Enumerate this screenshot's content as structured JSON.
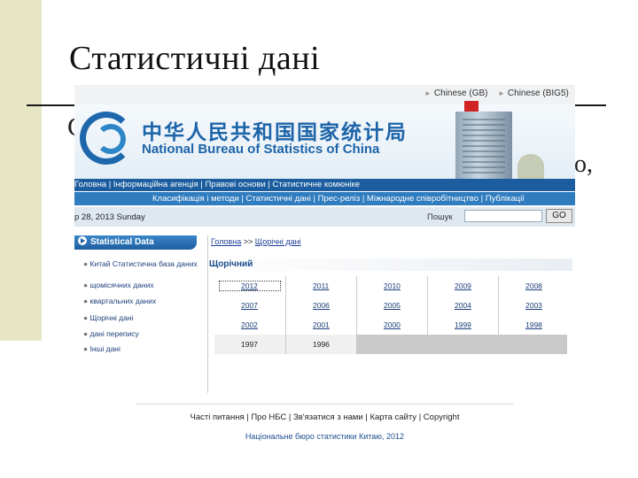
{
  "slide": {
    "title": "Статистичні дані",
    "fragment_left": "С",
    "fragment_right": "о,"
  },
  "header": {
    "lang_gb": "Chinese (GB)",
    "lang_big5": "Chinese (BIG5)",
    "cn_name": "中华人民共和国国家统计局",
    "en_name": "National Bureau of Statistics of China"
  },
  "nav": {
    "row1": "Головна | Інформаційна агенція | Правові основи | Статистичне комюніке",
    "row2": "Класифікація і методи | Статистичні дані | Прес-реліз | Міжнародне співробітництво | Публікації"
  },
  "datebar": {
    "date": "р 28, 2013 Sunday",
    "search_label": "Пошук",
    "search_value": "",
    "go_label": "GO"
  },
  "sidebar": {
    "heading": "Statistical Data",
    "items": [
      "Китай Статистична база даних",
      "щомісячних даних",
      "квартальних даних",
      "Щорічні дані",
      "дані перепису",
      "Інші дані"
    ]
  },
  "main": {
    "breadcrumb_home": "Головна",
    "breadcrumb_sep": ">>",
    "breadcrumb_current": "Щорічні дані",
    "section_title": "Щорічний",
    "years": [
      [
        "2012",
        "2011",
        "2010",
        "2009",
        "2008"
      ],
      [
        "2007",
        "2006",
        "2005",
        "2004",
        "2003"
      ],
      [
        "2002",
        "2001",
        "2000",
        "1999",
        "1998"
      ],
      [
        "1997",
        "1996"
      ]
    ]
  },
  "footer": {
    "links": "Часті питання | Про НБС | Зв'язатися з нами | Карта сайту | Copyright",
    "copyright": "Національне бюро статистики Китаю, 2012"
  }
}
